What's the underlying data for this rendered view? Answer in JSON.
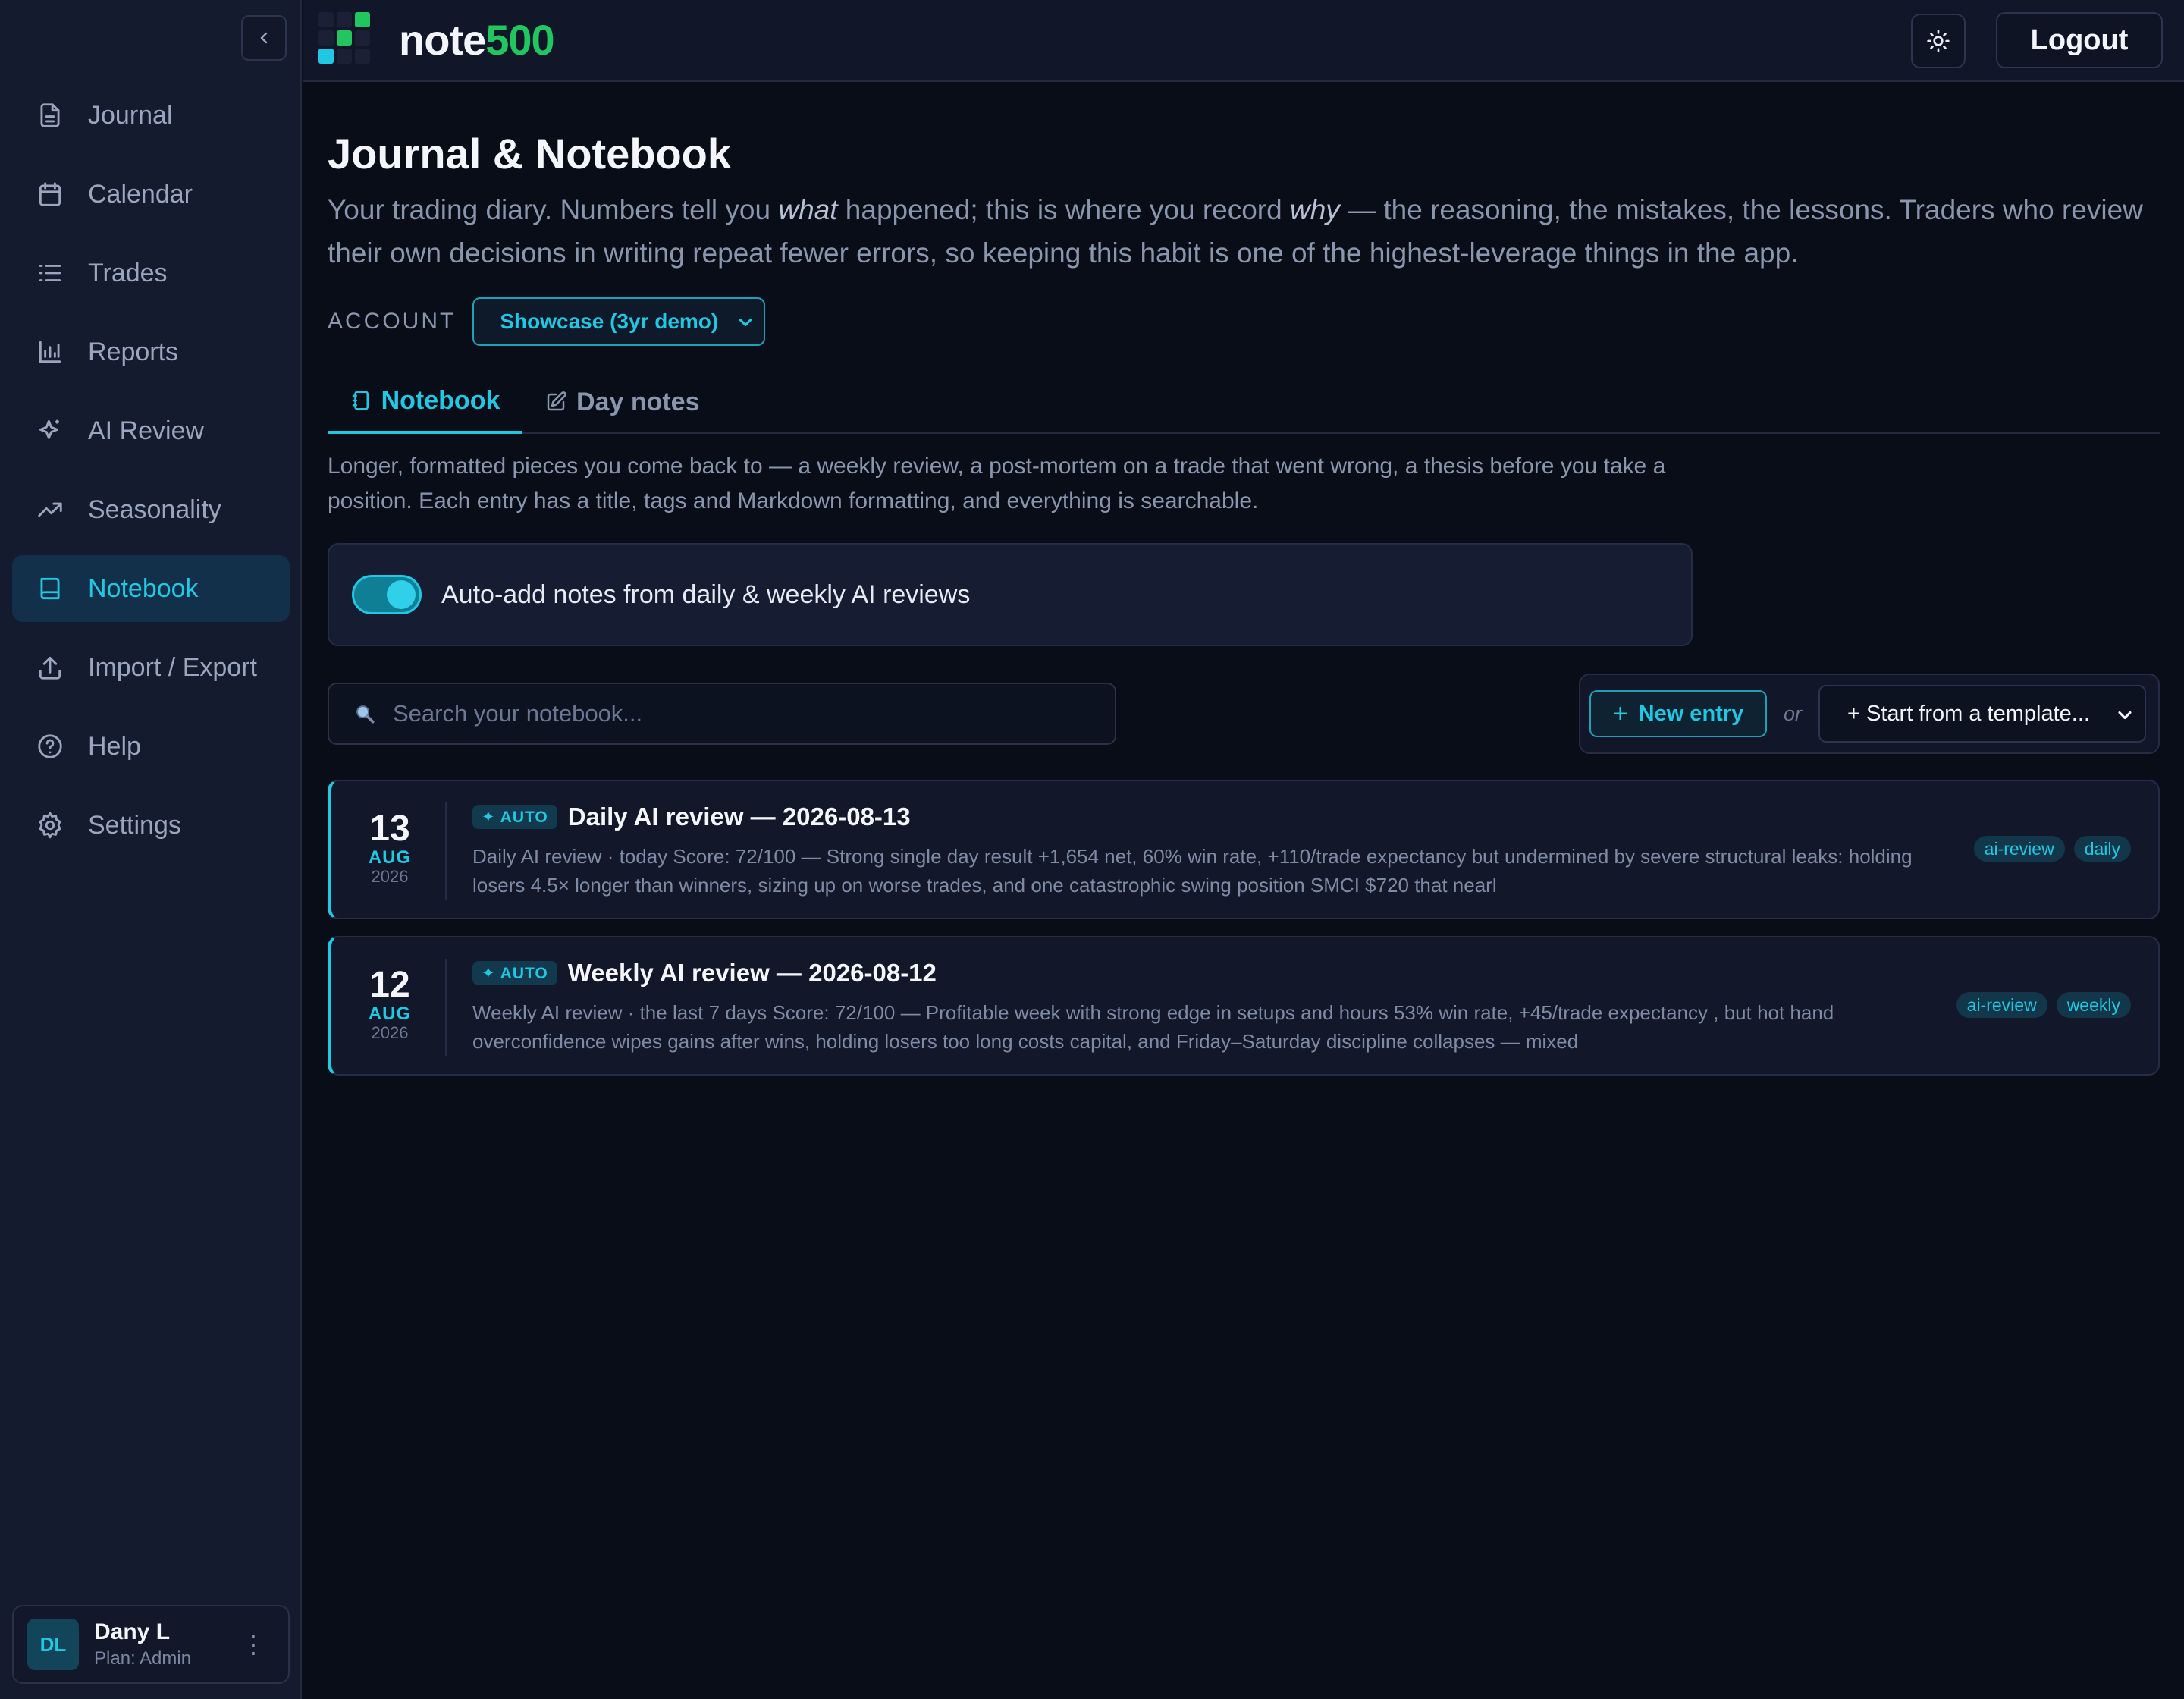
{
  "brand": {
    "name_part1": "note",
    "name_part2": "500"
  },
  "header": {
    "logout_label": "Logout"
  },
  "sidebar": {
    "items": [
      {
        "label": "Journal",
        "icon": "file-text-icon"
      },
      {
        "label": "Calendar",
        "icon": "calendar-icon"
      },
      {
        "label": "Trades",
        "icon": "list-icon"
      },
      {
        "label": "Reports",
        "icon": "bar-chart-icon"
      },
      {
        "label": "AI Review",
        "icon": "sparkle-icon"
      },
      {
        "label": "Seasonality",
        "icon": "trending-up-icon"
      },
      {
        "label": "Notebook",
        "icon": "book-icon",
        "active": true
      },
      {
        "label": "Import / Export",
        "icon": "upload-icon"
      },
      {
        "label": "Help",
        "icon": "help-circle-icon"
      },
      {
        "label": "Settings",
        "icon": "gear-icon"
      }
    ],
    "user": {
      "initials": "DL",
      "name": "Dany L",
      "plan": "Plan: Admin"
    }
  },
  "page": {
    "title": "Journal & Notebook",
    "intro_1": "Your trading diary. Numbers tell you ",
    "intro_em1": "what",
    "intro_2": " happened; this is where you record ",
    "intro_em2": "why",
    "intro_3": " — the reasoning, the mistakes, the lessons. Traders who review their own decisions in writing repeat fewer errors, so keeping this habit is one of the highest-leverage things in the app.",
    "account_label": "ACCOUNT",
    "account_value": "Showcase (3yr demo)"
  },
  "tabs": [
    {
      "label": "Notebook",
      "active": true
    },
    {
      "label": "Day notes",
      "active": false
    }
  ],
  "notebook": {
    "description": "Longer, formatted pieces you come back to — a weekly review, a post-mortem on a trade that went wrong, a thesis before you take a position. Each entry has a title, tags and Markdown formatting, and everything is searchable.",
    "auto_add_label": "Auto-add notes from daily & weekly AI reviews",
    "auto_add_enabled": true,
    "search_placeholder": "Search your notebook...",
    "new_entry_label": "New entry",
    "or_label": "or",
    "template_label": "+ Start from a template..."
  },
  "entries": [
    {
      "day": "13",
      "month": "AUG",
      "year": "2026",
      "badge": "✦ AUTO",
      "title": "Daily AI review — 2026-08-13",
      "snippet": "Daily AI review · today Score: 72/100 — Strong single day result +1,654 net, 60% win rate, +110/trade expectancy but undermined by severe structural leaks: holding losers 4.5× longer than winners, sizing up on worse trades, and one catastrophic swing position SMCI $720 that nearl",
      "tags": [
        "ai-review",
        "daily"
      ]
    },
    {
      "day": "12",
      "month": "AUG",
      "year": "2026",
      "badge": "✦ AUTO",
      "title": "Weekly AI review — 2026-08-12",
      "snippet": "Weekly AI review · the last 7 days Score: 72/100 — Profitable week with strong edge in setups and hours 53% win rate, +45/trade expectancy , but hot hand overconfidence wipes gains after wins, holding losers too long costs capital, and Friday–Saturday discipline collapses — mixed",
      "tags": [
        "ai-review",
        "weekly"
      ]
    }
  ],
  "colors": {
    "accent": "#22c7e3",
    "brand_green": "#22c55e",
    "background": "#090d18",
    "sidebar": "#151b2e"
  }
}
